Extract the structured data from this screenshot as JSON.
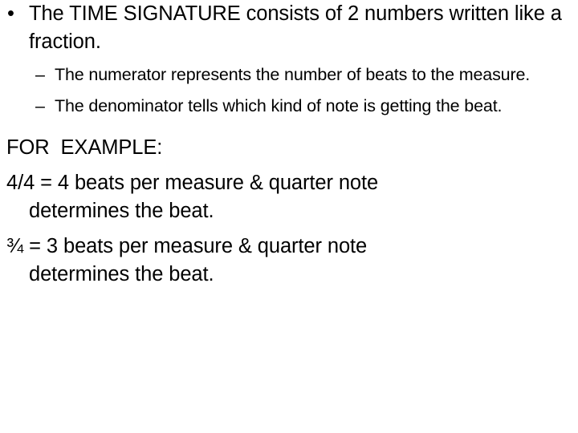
{
  "slide": {
    "background_color": "#ffffff",
    "text_color": "#000000",
    "bullets": {
      "level1_marker": "•",
      "level2_marker": "–"
    },
    "level1": {
      "text": "The TIME SIGNATURE consists of 2 numbers written like a fraction."
    },
    "level2": [
      {
        "text": "The numerator represents the number of beats to the measure."
      },
      {
        "text": "The denominator tells which kind of note is getting the beat."
      }
    ],
    "example_heading": "FOR  EXAMPLE:",
    "examples": [
      {
        "line1": "4/4 = 4 beats per measure & quarter note",
        "line2": "determines the beat."
      },
      {
        "line1": "¾ = 3 beats per measure & quarter note",
        "line2": "determines the beat."
      }
    ]
  }
}
